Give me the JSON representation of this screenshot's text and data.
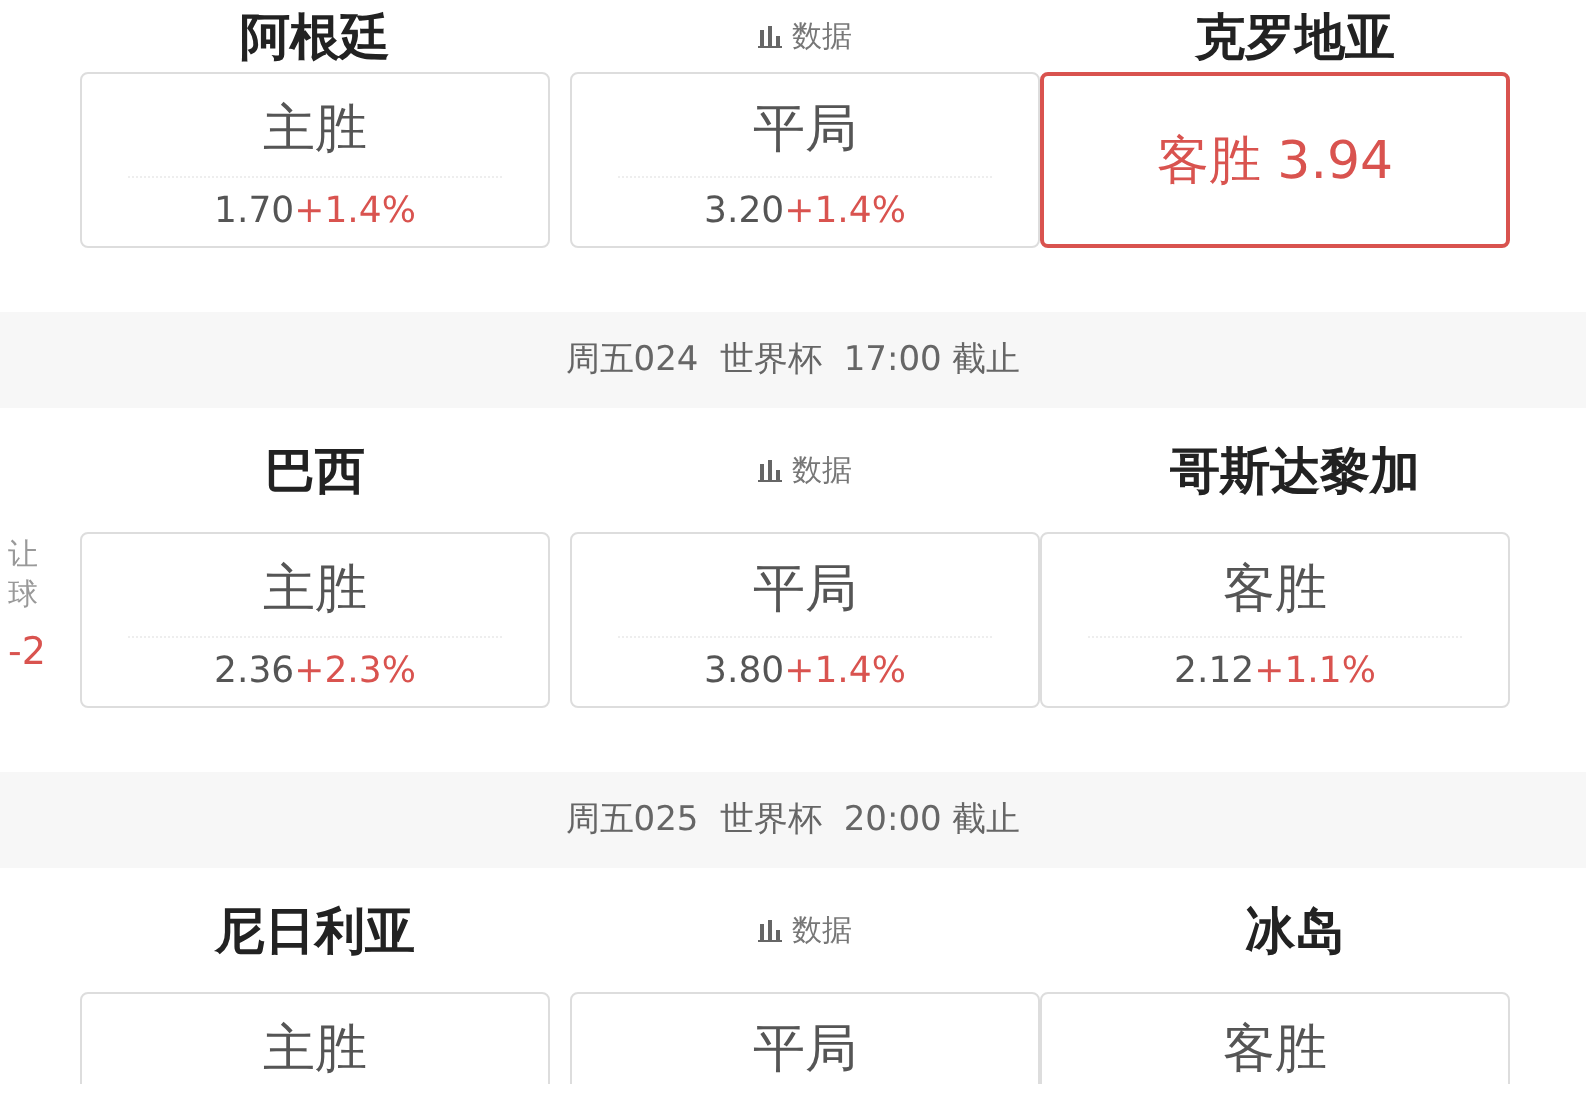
{
  "matches": [
    {
      "home": "阿根廷",
      "away": "克罗地亚",
      "data_label": "数据",
      "options": [
        {
          "label": "主胜",
          "odds": "1.70",
          "change": "+1.4%",
          "selected": false
        },
        {
          "label": "平局",
          "odds": "3.20",
          "change": "+1.4%",
          "selected": false
        },
        {
          "label": "客胜",
          "odds": "3.94",
          "selected": true
        }
      ]
    },
    {
      "header": "周五024  世界杯  17:00 截止",
      "home": "巴西",
      "away": "哥斯达黎加",
      "data_label": "数据",
      "handicap": {
        "label": "让球",
        "value": "-2"
      },
      "options": [
        {
          "label": "主胜",
          "odds": "2.36",
          "change": "+2.3%",
          "selected": false
        },
        {
          "label": "平局",
          "odds": "3.80",
          "change": "+1.4%",
          "selected": false
        },
        {
          "label": "客胜",
          "odds": "2.12",
          "change": "+1.1%",
          "selected": false
        }
      ]
    },
    {
      "header": "周五025  世界杯  20:00 截止",
      "home": "尼日利亚",
      "away": "冰岛",
      "data_label": "数据",
      "options": [
        {
          "label": "主胜",
          "selected": false
        },
        {
          "label": "平局",
          "selected": false
        },
        {
          "label": "客胜",
          "selected": false
        }
      ]
    }
  ]
}
